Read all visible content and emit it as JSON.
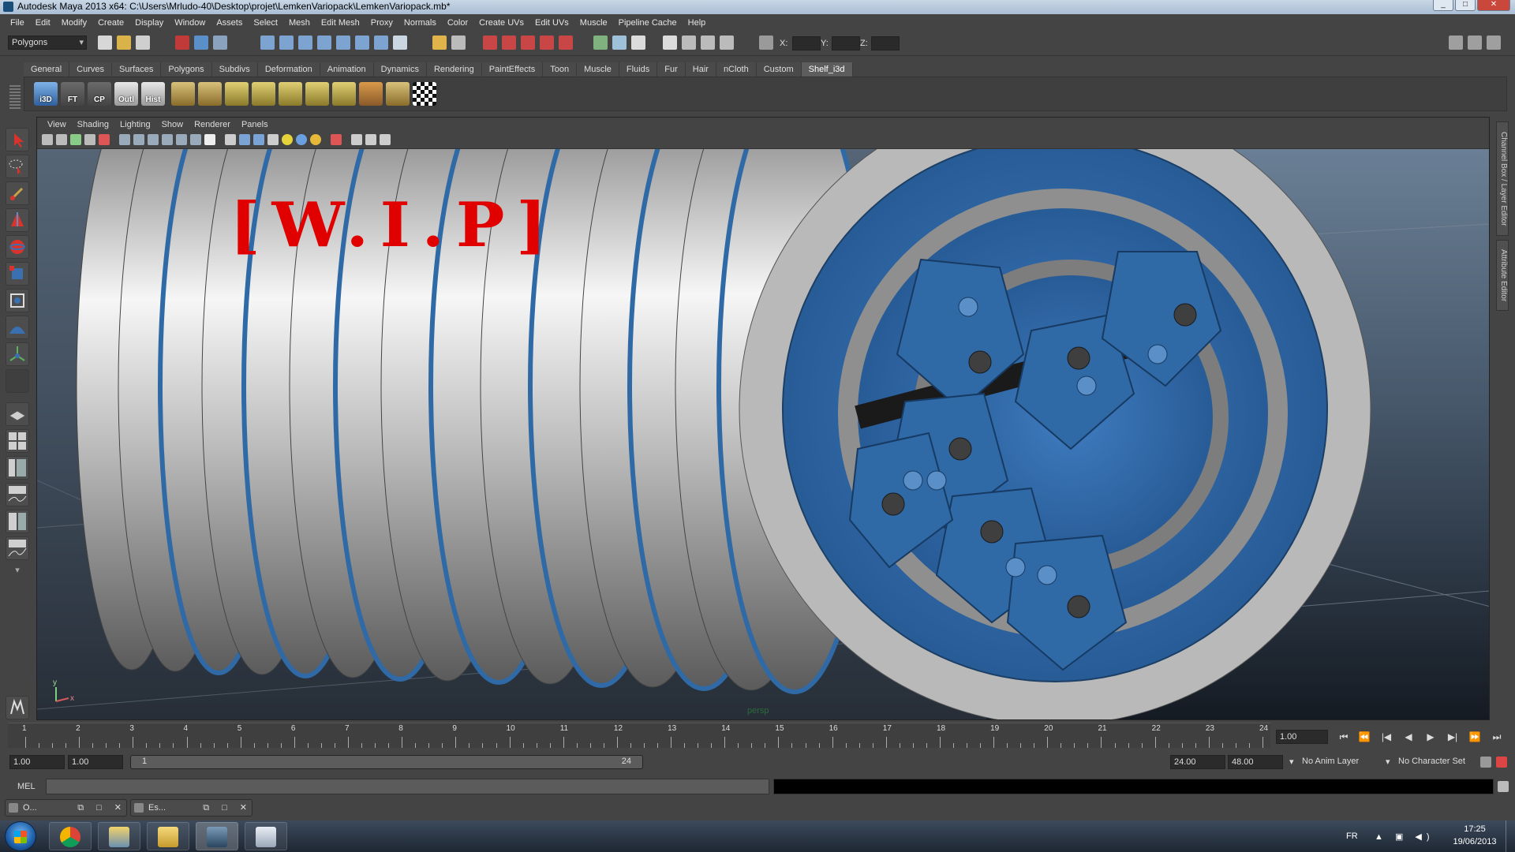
{
  "window": {
    "title": "Autodesk Maya 2013 x64: C:\\Users\\Mrludo-40\\Desktop\\projet\\LemkenVariopack\\LemkenVariopack.mb*",
    "controls": [
      "_",
      "□",
      "✕"
    ]
  },
  "menubar": {
    "items": [
      "File",
      "Edit",
      "Modify",
      "Create",
      "Display",
      "Window",
      "Assets",
      "Select",
      "Mesh",
      "Edit Mesh",
      "Proxy",
      "Normals",
      "Color",
      "Create UVs",
      "Edit UVs",
      "Muscle",
      "Pipeline Cache",
      "Help"
    ]
  },
  "statusline": {
    "mode": "Polygons",
    "x_label": "X:",
    "y_label": "Y:",
    "z_label": "Z:"
  },
  "shelf": {
    "tabs": [
      "General",
      "Curves",
      "Surfaces",
      "Polygons",
      "Subdivs",
      "Deformation",
      "Animation",
      "Dynamics",
      "Rendering",
      "PaintEffects",
      "Toon",
      "Muscle",
      "Fluids",
      "Fur",
      "Hair",
      "nCloth",
      "Custom",
      "Shelf_i3d"
    ],
    "active": "Shelf_i3d",
    "buttons": [
      "i3D",
      "FT",
      "CP",
      "Outl",
      "Hist"
    ]
  },
  "viewport": {
    "menu": [
      "View",
      "Shading",
      "Lighting",
      "Show",
      "Renderer",
      "Panels"
    ],
    "overlay_text": "[W.I.P]",
    "camera": "persp",
    "axis_y": "y",
    "axis_x": "x"
  },
  "colors": {
    "accent_red": "#e10000",
    "ring_blue": "#2f6aa6",
    "metal": "#a9a9a9"
  },
  "rightdock": {
    "tabs": [
      "Channel Box / Layer Editor",
      "Attribute Editor"
    ]
  },
  "timeslider": {
    "ticks": [
      "1",
      "2",
      "3",
      "4",
      "5",
      "6",
      "7",
      "8",
      "9",
      "10",
      "11",
      "12",
      "13",
      "14",
      "15",
      "16",
      "17",
      "18",
      "19",
      "20",
      "21",
      "22",
      "23",
      "24"
    ],
    "current_frame": "1.00",
    "playback": [
      "⏮",
      "⏪",
      "|◀",
      "◀",
      "▶",
      "▶|",
      "⏩",
      "⏭"
    ]
  },
  "range": {
    "start": "1.00",
    "playback_start": "1.00",
    "inner_start": "1",
    "inner_end": "24",
    "playback_end": "24.00",
    "end": "48.00",
    "anim_layer": "No Anim Layer",
    "character_set": "No Character Set"
  },
  "cmdline": {
    "label": "MEL"
  },
  "minimized_windows": [
    {
      "label": "O..."
    },
    {
      "label": "Es..."
    }
  ],
  "taskbar": {
    "lang": "FR",
    "time": "17:25",
    "date": "19/06/2013",
    "tray_icons": "▲ ▣ ◀)"
  }
}
